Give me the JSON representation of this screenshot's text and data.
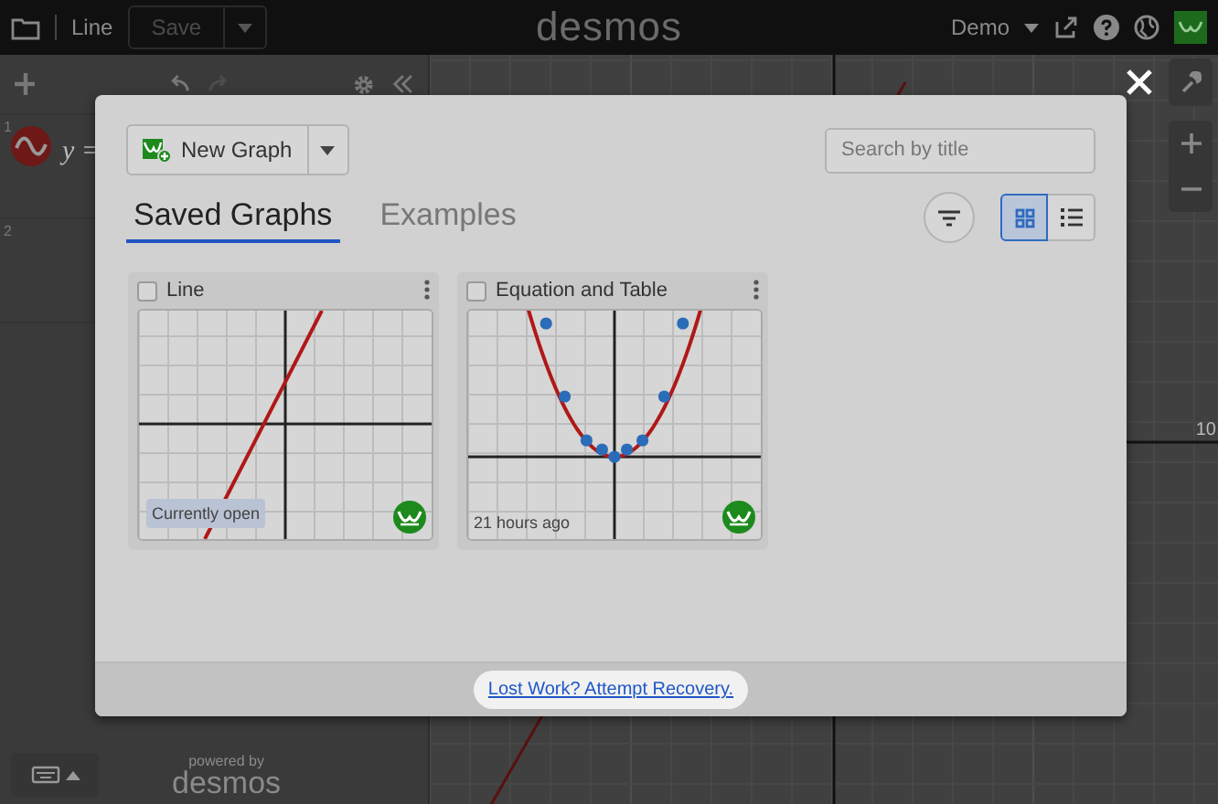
{
  "topbar": {
    "file_title": "Line",
    "save_button": "Save",
    "logo": "desmos",
    "user_menu": "Demo"
  },
  "expressions": [
    {
      "index": "1",
      "formula": "y ="
    },
    {
      "index": "2"
    }
  ],
  "graph": {
    "axis_label": "10"
  },
  "footer": {
    "powered_by": "powered by",
    "logo": "desmos"
  },
  "dialog": {
    "new_graph_button": "New Graph",
    "search": {
      "placeholder": "Search by title"
    },
    "tabs": [
      {
        "label": "Saved Graphs",
        "selected": true
      },
      {
        "label": "Examples",
        "selected": false
      }
    ],
    "views": [
      {
        "kind": "grid",
        "selected": true
      },
      {
        "kind": "list",
        "selected": false
      }
    ],
    "graphs": [
      {
        "title": "Line",
        "checked": false,
        "kind": "line",
        "current": true,
        "status": "Currently open"
      },
      {
        "title": "Equation and Table",
        "checked": false,
        "kind": "parabola",
        "current": false,
        "status": "21 hours ago"
      }
    ],
    "recovery_link": "Lost Work? Attempt Recovery."
  }
}
